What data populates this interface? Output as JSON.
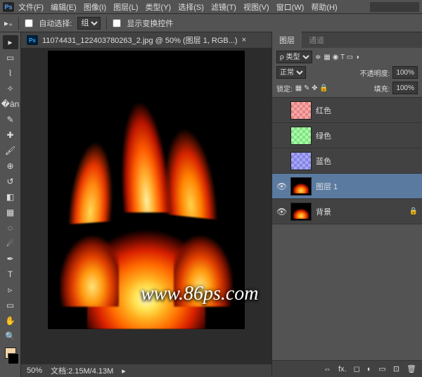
{
  "menu": {
    "items": [
      "文件(F)",
      "编辑(E)",
      "图像(I)",
      "图层(L)",
      "类型(Y)",
      "选择(S)",
      "滤镜(T)",
      "视图(V)",
      "窗口(W)",
      "帮助(H)"
    ]
  },
  "options": {
    "auto_select": "自动选择:",
    "group": "组",
    "show_transform": "显示变换控件"
  },
  "document": {
    "tab_title": "11074431_122403780263_2.jpg @ 50% (图层 1, RGB...)",
    "zoom": "50%",
    "doc_info": "文档:2.15M/4.13M"
  },
  "panels": {
    "tab_layers": "图层",
    "tab_channels": "通道",
    "filter_label": "ρ 类型",
    "blend_mode": "正常",
    "opacity_label": "不透明度:",
    "opacity_val": "100%",
    "lock_label": "锁定:",
    "fill_label": "填充:",
    "fill_val": "100%"
  },
  "layers": [
    {
      "name": "红色",
      "visible": false,
      "thumb": "red",
      "selected": false,
      "locked": false
    },
    {
      "name": "绿色",
      "visible": false,
      "thumb": "green",
      "selected": false,
      "locked": false
    },
    {
      "name": "蓝色",
      "visible": false,
      "thumb": "blue",
      "selected": false,
      "locked": false
    },
    {
      "name": "图层 1",
      "visible": true,
      "thumb": "fire",
      "selected": true,
      "locked": false
    },
    {
      "name": "背景",
      "visible": true,
      "thumb": "fire",
      "selected": false,
      "locked": true
    }
  ],
  "watermark": "www.86ps.com"
}
